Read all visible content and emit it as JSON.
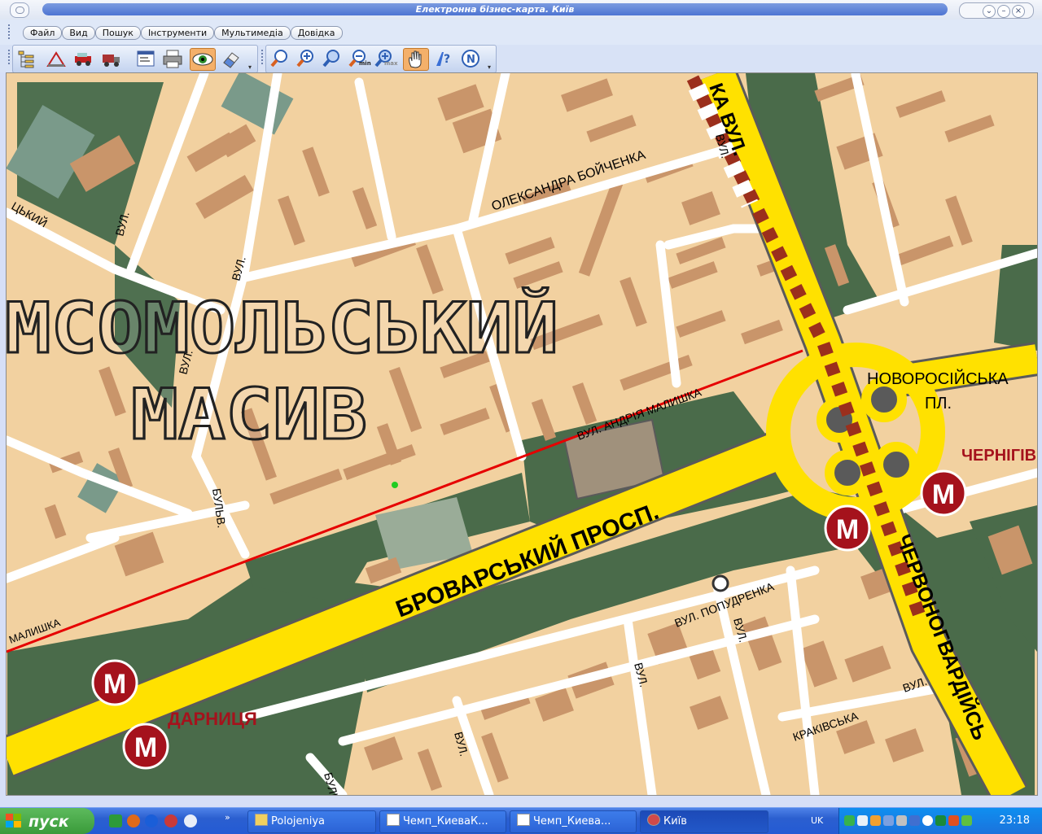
{
  "window": {
    "title": "Електронна бізнес-карта. Київ"
  },
  "menu": {
    "items": [
      "Файл",
      "Вид",
      "Пошук",
      "Інструменти",
      "Мультимедіа",
      "Довідка"
    ]
  },
  "toolbar": {
    "buttons": [
      "layers-icon",
      "measure-icon",
      "route-car-icon",
      "route-truck-icon",
      "window-icon",
      "print-icon",
      "view-eye-icon",
      "eraser-icon",
      "zoom-icon",
      "zoom-in-icon",
      "zoom-extent-icon",
      "zoom-min-icon",
      "zoom-max-icon",
      "pan-hand-icon",
      "help-icon",
      "north-icon"
    ],
    "zoom_min_label": "min",
    "zoom_max_label": "max"
  },
  "map": {
    "district": {
      "line1": "МСОМОЛЬСЬКИЙ",
      "line2": "МАСИВ"
    },
    "streets": {
      "brovarskyi": "БРОВАРСЬКИЙ  ПРОСП.",
      "chervonogvardiiska": "ЧЕРВОНОГВАРДІЙСЬ",
      "boichenko": "ОЛЕКСАНДРА БОЙЧЕНКА",
      "vul_top": "КА ВУЛ.",
      "malyshko": "ВУЛ. АНДРІЯ МАЛИШКА",
      "malyshko_short": "МАЛИШКА",
      "novorossiiska": "НОВОРОСІЙСЬКА",
      "pl": "ПЛ.",
      "popudrenka": "ВУЛ.  ПОПУДРЕНКА",
      "krakivska": "КРАКІВСЬКА",
      "bulv": "БУЛЬВ.",
      "vul": "ВУЛ.",
      "tskyi": "ЦЬКИЙ"
    },
    "metro": {
      "symbol": "М",
      "darnytsia": "ДАРНИЦЯ",
      "chernihivska": "ЧЕРНІГІВ"
    }
  },
  "taskbar": {
    "start": "пуск",
    "tasks": [
      "Polojeniya",
      "Чемп_КиеваК...",
      "Чемп_Киева...",
      "Київ"
    ],
    "language": "UK",
    "time": "23:18"
  },
  "colors": {
    "block": "#f2d1a0",
    "building": "#c9956a",
    "park": "#4a6b4a",
    "highway": "#ffe100",
    "metro": "#a5121c"
  }
}
